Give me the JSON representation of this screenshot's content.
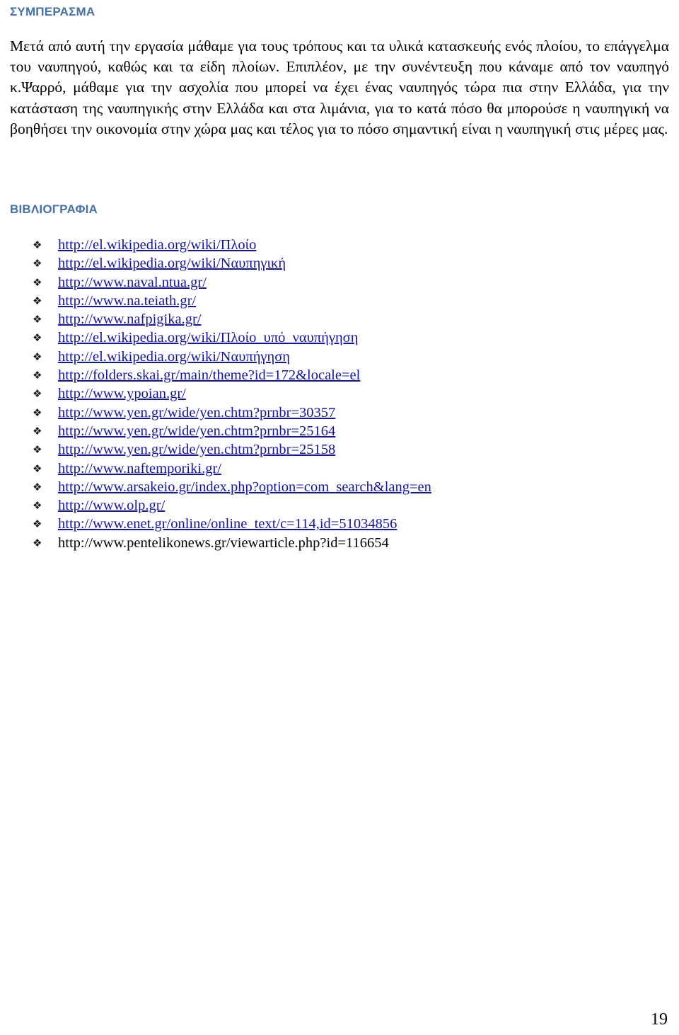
{
  "document": {
    "page_number": "19",
    "colors": {
      "heading": "#4472A8",
      "link": "#1414A6",
      "text": "#000000",
      "background": "#FFFFFF"
    }
  },
  "conclusion": {
    "heading": "ΣΥΜΠΕΡΑΣΜΑ",
    "paragraph": "Μετά από αυτή την εργασία μάθαμε για τους τρόπους και τα υλικά κατασκευής ενός πλοίου, το επάγγελμα του ναυπηγού, καθώς και τα είδη πλοίων. Επιπλέον, με την συνέντευξη που κάναμε από τον ναυπηγό κ.Ψαρρό, μάθαμε για την ασχολία που μπορεί να έχει ένας ναυπηγός τώρα πια στην Ελλάδα, για την κατάσταση της ναυπηγικής στην Ελλάδα και στα λιμάνια, για το κατά πόσο θα μπορούσε η ναυπηγική να βοηθήσει την οικονομία στην χώρα μας και τέλος για το πόσο σημαντική είναι η ναυπηγική στις μέρες μας."
  },
  "bibliography": {
    "heading": "ΒΙΒΛΙΟΓΡΑΦΙΑ",
    "bullet_glyph": "❖",
    "items": [
      {
        "text": "http://el.wikipedia.org/wiki/Πλοίο",
        "is_link": true
      },
      {
        "text": "http://el.wikipedia.org/wiki/Ναυπηγική",
        "is_link": true
      },
      {
        "text": "http://www.naval.ntua.gr/",
        "is_link": true
      },
      {
        "text": "http://www.na.teiath.gr/",
        "is_link": true
      },
      {
        "text": "http://www.nafpigika.gr/",
        "is_link": true
      },
      {
        "text": "http://el.wikipedia.org/wiki/Πλοίο_υπό_ναυπήγηση",
        "is_link": true
      },
      {
        "text": "http://el.wikipedia.org/wiki/Ναυπήγηση",
        "is_link": true
      },
      {
        "text": "http://folders.skai.gr/main/theme?id=172&locale=el",
        "is_link": true
      },
      {
        "text": "http://www.ypoian.gr/",
        "is_link": true
      },
      {
        "text": "http://www.yen.gr/wide/yen.chtm?prnbr=30357",
        "is_link": true
      },
      {
        "text": "http://www.yen.gr/wide/yen.chtm?prnbr=25164",
        "is_link": true
      },
      {
        "text": "http://www.yen.gr/wide/yen.chtm?prnbr=25158",
        "is_link": true
      },
      {
        "text": "http://www.naftemporiki.gr/",
        "is_link": true
      },
      {
        "text": "http://www.arsakeio.gr/index.php?option=com_search&lang=en",
        "is_link": true
      },
      {
        "text": "http://www.olp.gr/",
        "is_link": true
      },
      {
        "text": "http://www.enet.gr/online/online_text/c=114,id=51034856",
        "is_link": true
      },
      {
        "text": "http://www.pentelikonews.gr/viewarticle.php?id=116654",
        "is_link": false
      }
    ]
  }
}
